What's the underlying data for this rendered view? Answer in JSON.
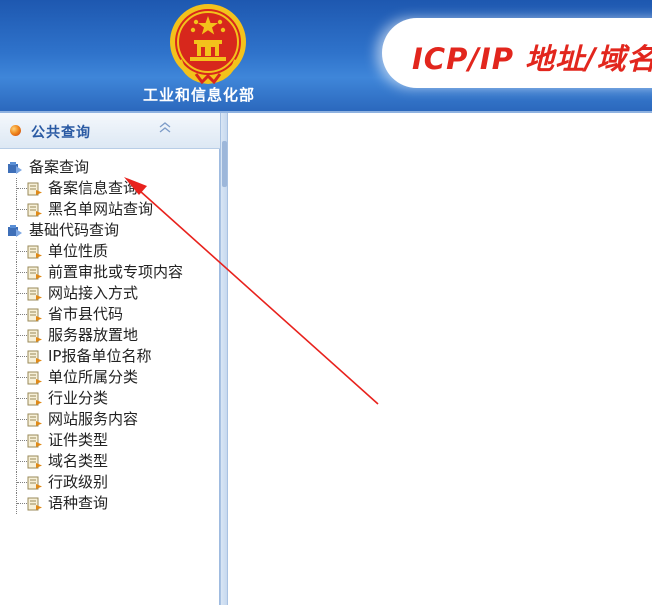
{
  "header": {
    "org_name": "工业和信息化部",
    "title": "ICP/IP 地址/域名"
  },
  "sidebar": {
    "head_label": "公共查询",
    "groups": [
      {
        "label": "备案查询",
        "items": [
          {
            "label": "备案信息查询"
          },
          {
            "label": "黑名单网站查询"
          }
        ]
      },
      {
        "label": "基础代码查询",
        "items": [
          {
            "label": "单位性质"
          },
          {
            "label": "前置审批或专项内容"
          },
          {
            "label": "网站接入方式"
          },
          {
            "label": "省市县代码"
          },
          {
            "label": "服务器放置地"
          },
          {
            "label": "IP报备单位名称"
          },
          {
            "label": "单位所属分类"
          },
          {
            "label": "行业分类"
          },
          {
            "label": "网站服务内容"
          },
          {
            "label": "证件类型"
          },
          {
            "label": "域名类型"
          },
          {
            "label": "行政级别"
          },
          {
            "label": "语种查询"
          }
        ]
      }
    ]
  },
  "icons": {
    "emblem": "national-emblem-icon",
    "head_ball": "orange-ball-icon",
    "collapse": "double-chevron-up-icon",
    "group": "folder-icon",
    "leaf": "document-arrow-icon"
  },
  "colors": {
    "header_blue": "#2f73cb",
    "title_red": "#e2261d",
    "sidebar_head_text": "#2a5aa3",
    "annotation_red": "#e8221d"
  }
}
